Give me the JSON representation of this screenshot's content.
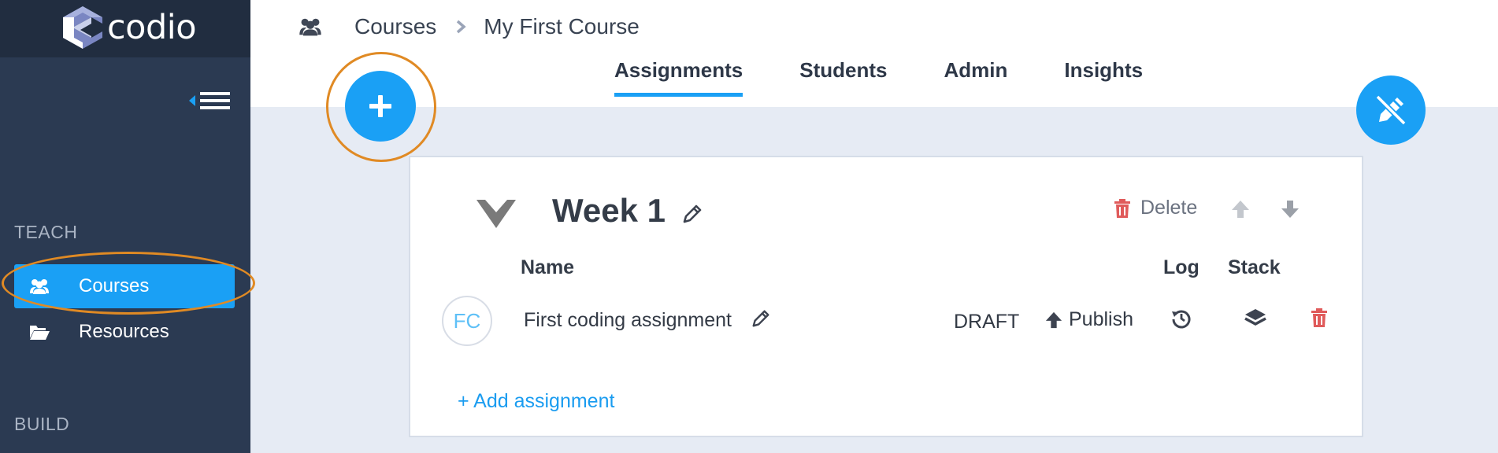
{
  "app": {
    "logo_text": "codio"
  },
  "sidebar": {
    "sections": [
      "TEACH",
      "BUILD"
    ],
    "items": [
      {
        "label": "Courses",
        "icon": "users-icon",
        "active": true
      },
      {
        "label": "Resources",
        "icon": "folder-open-icon",
        "active": false
      }
    ]
  },
  "breadcrumb": [
    "Courses",
    "My First Course"
  ],
  "tabs": [
    {
      "label": "Assignments",
      "active": true
    },
    {
      "label": "Students",
      "active": false
    },
    {
      "label": "Admin",
      "active": false
    },
    {
      "label": "Insights",
      "active": false
    }
  ],
  "week": {
    "title": "Week 1",
    "delete_label": "Delete",
    "columns": {
      "name": "Name",
      "log": "Log",
      "stack": "Stack"
    },
    "assignments": [
      {
        "avatar": "FC",
        "name": "First coding assignment",
        "status": "DRAFT",
        "publish_label": "Publish"
      }
    ],
    "add_label": "+ Add assignment"
  },
  "colors": {
    "sidebar_bg": "#2b3a52",
    "accent": "#1aa0f5",
    "highlight": "#e08a24",
    "danger": "#e05b5b"
  }
}
